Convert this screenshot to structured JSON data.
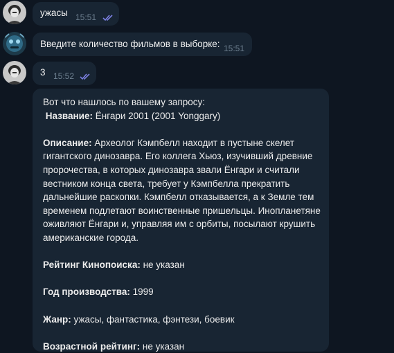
{
  "messages": [
    {
      "text": "ужасы",
      "time": "15:51"
    },
    {
      "text": "Введите количество фильмов в выборке:",
      "time": "15:51"
    },
    {
      "text": "3",
      "time": "15:52"
    }
  ],
  "result": {
    "intro": "Вот что нашлось по вашему запросу:",
    "name_label": "Название:",
    "name_value": "Ёнгари 2001 (2001 Yonggary)",
    "desc_label": "Описание:",
    "desc_lines": [
      "Археолог Кэмпбелл находит в пустыне скелет",
      "гигантского динозавра. Его коллега Хьюз, изучивший древние",
      "пророчества, в которых динозавра звали Ёнгари и считали",
      "вестником конца света, требует у Кэмпбелла прекратить",
      "дальнейшие раскопки. Кэмпбелл отказывается, а к Земле тем",
      "временем подлетают воинственные пришельцы. Инопланетяне",
      "оживляют Ёнгари и, управляя им с орбиты, посылают крушить",
      "американские города."
    ],
    "rating_label": "Рейтинг Кинопоиска:",
    "rating_value": "не указан",
    "year_label": "Год производства:",
    "year_value": "1999",
    "genre_label": "Жанр:",
    "genre_value": "ужасы, фантастика, фэнтези, боевик",
    "age_label": "Возрастной рейтинг:",
    "age_value": "не указан"
  },
  "colors": {
    "background": "#0e1621",
    "bubble": "#182533",
    "time": "#6d7f8f",
    "read_checks": "#7b7fe0"
  }
}
